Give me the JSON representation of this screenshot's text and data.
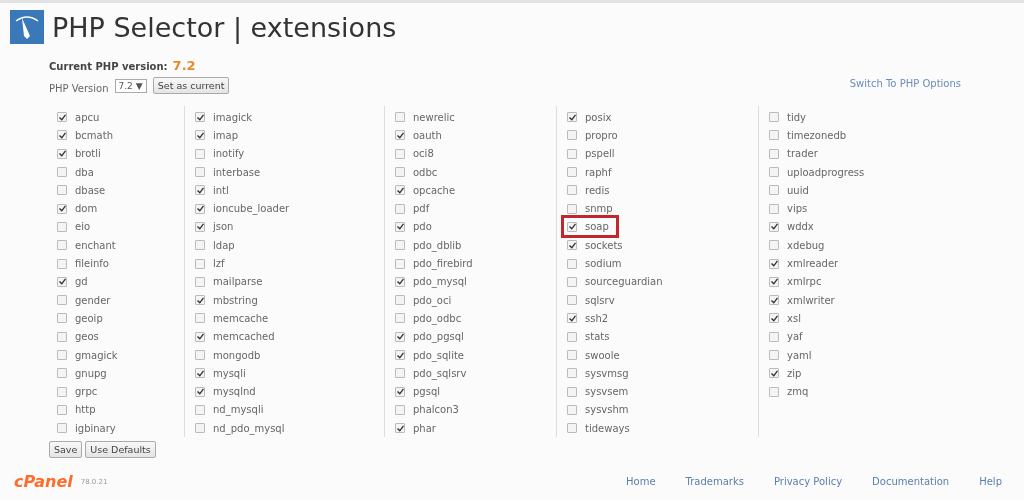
{
  "header": {
    "title": "PHP Selector | extensions"
  },
  "current_version": {
    "label": "Current PHP version:",
    "value": "7.2"
  },
  "version_select": {
    "label": "PHP Version",
    "value": "7.2",
    "caret": "▼",
    "button": "Set as current"
  },
  "switch_link": "Switch To PHP Options",
  "columns": [
    {
      "items": [
        {
          "name": "apcu",
          "checked": true
        },
        {
          "name": "bcmath",
          "checked": true
        },
        {
          "name": "brotli",
          "checked": true
        },
        {
          "name": "dba",
          "checked": false
        },
        {
          "name": "dbase",
          "checked": false
        },
        {
          "name": "dom",
          "checked": true
        },
        {
          "name": "eio",
          "checked": false
        },
        {
          "name": "enchant",
          "checked": false
        },
        {
          "name": "fileinfo",
          "checked": false
        },
        {
          "name": "gd",
          "checked": true
        },
        {
          "name": "gender",
          "checked": false
        },
        {
          "name": "geoip",
          "checked": false
        },
        {
          "name": "geos",
          "checked": false
        },
        {
          "name": "gmagick",
          "checked": false
        },
        {
          "name": "gnupg",
          "checked": false
        },
        {
          "name": "grpc",
          "checked": false
        },
        {
          "name": "http",
          "checked": false
        },
        {
          "name": "igbinary",
          "checked": false
        }
      ]
    },
    {
      "items": [
        {
          "name": "imagick",
          "checked": true
        },
        {
          "name": "imap",
          "checked": true
        },
        {
          "name": "inotify",
          "checked": false
        },
        {
          "name": "interbase",
          "checked": false
        },
        {
          "name": "intl",
          "checked": true
        },
        {
          "name": "ioncube_loader",
          "checked": true
        },
        {
          "name": "json",
          "checked": true
        },
        {
          "name": "ldap",
          "checked": false
        },
        {
          "name": "lzf",
          "checked": false
        },
        {
          "name": "mailparse",
          "checked": false
        },
        {
          "name": "mbstring",
          "checked": true
        },
        {
          "name": "memcache",
          "checked": false
        },
        {
          "name": "memcached",
          "checked": true
        },
        {
          "name": "mongodb",
          "checked": false
        },
        {
          "name": "mysqli",
          "checked": true
        },
        {
          "name": "mysqlnd",
          "checked": true
        },
        {
          "name": "nd_mysqli",
          "checked": false
        },
        {
          "name": "nd_pdo_mysql",
          "checked": false
        }
      ]
    },
    {
      "items": [
        {
          "name": "newrelic",
          "checked": false
        },
        {
          "name": "oauth",
          "checked": true
        },
        {
          "name": "oci8",
          "checked": false
        },
        {
          "name": "odbc",
          "checked": false
        },
        {
          "name": "opcache",
          "checked": true
        },
        {
          "name": "pdf",
          "checked": false
        },
        {
          "name": "pdo",
          "checked": true
        },
        {
          "name": "pdo_dblib",
          "checked": false
        },
        {
          "name": "pdo_firebird",
          "checked": false
        },
        {
          "name": "pdo_mysql",
          "checked": true
        },
        {
          "name": "pdo_oci",
          "checked": false
        },
        {
          "name": "pdo_odbc",
          "checked": false
        },
        {
          "name": "pdo_pgsql",
          "checked": true
        },
        {
          "name": "pdo_sqlite",
          "checked": true
        },
        {
          "name": "pdo_sqlsrv",
          "checked": false
        },
        {
          "name": "pgsql",
          "checked": true
        },
        {
          "name": "phalcon3",
          "checked": false
        },
        {
          "name": "phar",
          "checked": true
        }
      ]
    },
    {
      "items": [
        {
          "name": "posix",
          "checked": true
        },
        {
          "name": "propro",
          "checked": false
        },
        {
          "name": "pspell",
          "checked": false
        },
        {
          "name": "raphf",
          "checked": false
        },
        {
          "name": "redis",
          "checked": false
        },
        {
          "name": "snmp",
          "checked": false
        },
        {
          "name": "soap",
          "checked": true,
          "highlighted": true
        },
        {
          "name": "sockets",
          "checked": true
        },
        {
          "name": "sodium",
          "checked": false
        },
        {
          "name": "sourceguardian",
          "checked": false
        },
        {
          "name": "sqlsrv",
          "checked": false
        },
        {
          "name": "ssh2",
          "checked": true
        },
        {
          "name": "stats",
          "checked": false
        },
        {
          "name": "swoole",
          "checked": false
        },
        {
          "name": "sysvmsg",
          "checked": false
        },
        {
          "name": "sysvsem",
          "checked": false
        },
        {
          "name": "sysvshm",
          "checked": false
        },
        {
          "name": "tideways",
          "checked": false
        }
      ]
    },
    {
      "items": [
        {
          "name": "tidy",
          "checked": false
        },
        {
          "name": "timezonedb",
          "checked": false
        },
        {
          "name": "trader",
          "checked": false
        },
        {
          "name": "uploadprogress",
          "checked": false
        },
        {
          "name": "uuid",
          "checked": false
        },
        {
          "name": "vips",
          "checked": false
        },
        {
          "name": "wddx",
          "checked": true
        },
        {
          "name": "xdebug",
          "checked": false
        },
        {
          "name": "xmlreader",
          "checked": true
        },
        {
          "name": "xmlrpc",
          "checked": true
        },
        {
          "name": "xmlwriter",
          "checked": true
        },
        {
          "name": "xsl",
          "checked": true
        },
        {
          "name": "yaf",
          "checked": false
        },
        {
          "name": "yaml",
          "checked": false
        },
        {
          "name": "zip",
          "checked": true
        },
        {
          "name": "zmq",
          "checked": false
        }
      ]
    }
  ],
  "actions": [
    "Save",
    "Use Defaults"
  ],
  "footer": {
    "brand": "cPanel",
    "version": "78.0.21",
    "links": [
      "Home",
      "Trademarks",
      "Privacy Policy",
      "Documentation",
      "Help"
    ]
  }
}
